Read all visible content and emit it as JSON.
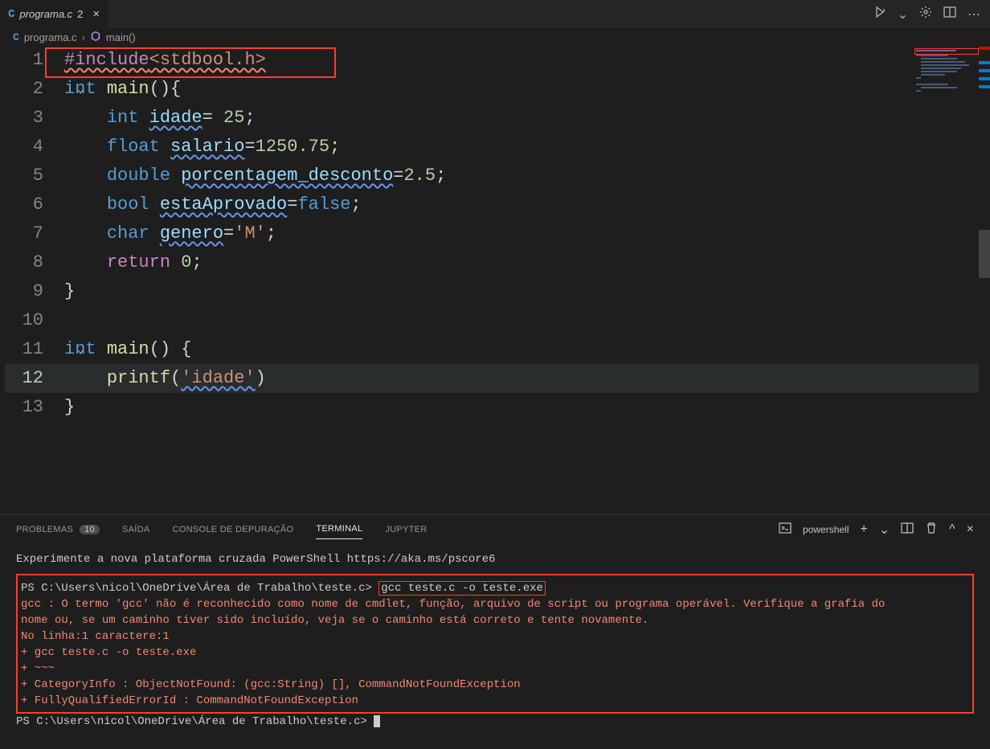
{
  "tab": {
    "filename": "programa.c",
    "dirty_indicator": "2",
    "lang_icon_letter": "C"
  },
  "breadcrumb": {
    "file": "programa.c",
    "symbol": "main()"
  },
  "editor": {
    "lines": [
      {
        "n": 1
      },
      {
        "n": 2
      },
      {
        "n": 3
      },
      {
        "n": 4
      },
      {
        "n": 5
      },
      {
        "n": 6
      },
      {
        "n": 7
      },
      {
        "n": 8
      },
      {
        "n": 9
      },
      {
        "n": 10
      },
      {
        "n": 11
      },
      {
        "n": 12
      },
      {
        "n": 13
      }
    ],
    "active_line": 12,
    "tokens": {
      "include": "#include",
      "header": "<stdbool.h>",
      "int": "int",
      "main": "main",
      "paren_open": "(",
      "paren_close": ")",
      "brace_open": "{",
      "brace_close": "}",
      "idade": "idade",
      "eq": "=",
      "v25": " 25",
      "semi": ";",
      "float": "float",
      "salario": "salario",
      "v1250": "1250.75",
      "double": "double",
      "porc": "porcentagem_desconto",
      "v25d": "2.5",
      "bool": "bool",
      "esta": "estaAprovado",
      "false": "false",
      "char": "char",
      "genero": "genero",
      "charM": "'M'",
      "return": "return",
      "zero": "0",
      "printf": "printf",
      "idade_str": "'idade'"
    }
  },
  "panel": {
    "tabs": {
      "problems": "PROBLEMAS",
      "problems_count": "10",
      "output": "SAÍDA",
      "debug": "CONSOLE DE DEPURAÇÃO",
      "terminal": "TERMINAL",
      "jupyter": "JUPYTER"
    },
    "shell_name": "powershell"
  },
  "terminal": {
    "intro": "Experimente a nova plataforma cruzada PowerShell https://aka.ms/pscore6",
    "prompt1_prefix": "PS C:\\Users\\nicol\\OneDrive\\Área de Trabalho\\teste.c> ",
    "cmd": "gcc teste.c -o teste.exe",
    "err1": "gcc : O termo 'gcc' não é reconhecido como nome de cmdlet, função, arquivo de script ou programa operável. Verifique a grafia do",
    "err2": "nome ou, se um caminho tiver sido incluído, veja se o caminho está correto e tente novamente.",
    "err3": "No linha:1 caractere:1",
    "err4": "+ gcc teste.c -o teste.exe",
    "err5": "+ ~~~",
    "err6": "    + CategoryInfo          : ObjectNotFound: (gcc:String) [], CommandNotFoundException",
    "err7": "    + FullyQualifiedErrorId : CommandNotFoundException",
    "prompt2": "PS C:\\Users\\nicol\\OneDrive\\Área de Trabalho\\teste.c> "
  }
}
